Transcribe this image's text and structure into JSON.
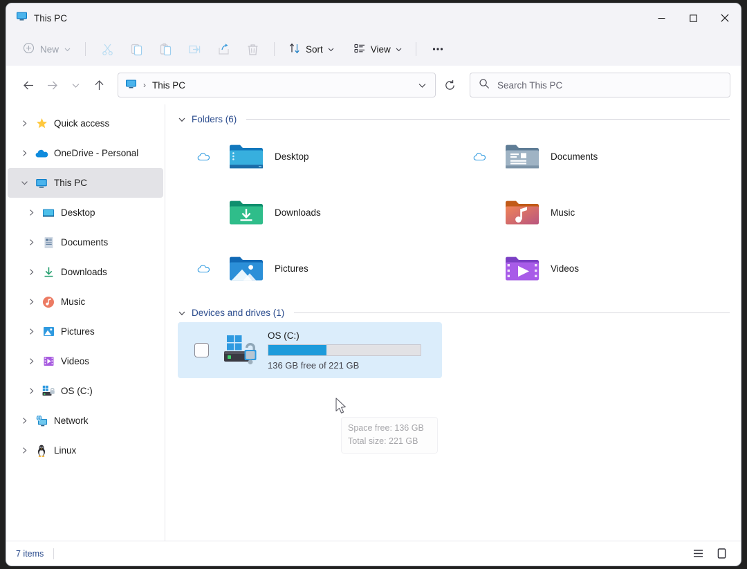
{
  "window": {
    "title": "This PC",
    "title_icon": "monitor-icon",
    "controls": {
      "minimize": "─",
      "maximize": "□",
      "close": "✕"
    }
  },
  "toolbar": {
    "new_label": "New",
    "sort_label": "Sort",
    "view_label": "View",
    "more_label": "•••",
    "icons": [
      "cut-icon",
      "copy-icon",
      "paste-icon",
      "rename-icon",
      "share-icon",
      "delete-icon"
    ]
  },
  "navigation": {
    "back_icon": "arrow-left-icon",
    "forward_icon": "arrow-right-icon",
    "history_icon": "chevron-down-icon",
    "up_icon": "arrow-up-icon",
    "refresh_icon": "refresh-icon",
    "breadcrumb": {
      "icon": "monitor-icon",
      "separator": "›",
      "label": "This PC"
    },
    "dropdown_icon": "chevron-down-icon"
  },
  "search": {
    "placeholder": "Search This PC",
    "icon": "search-icon"
  },
  "sidebar": {
    "items": [
      {
        "label": "Quick access",
        "icon": "star-icon",
        "chevron": "collapsed",
        "indent": false,
        "selected": false
      },
      {
        "label": "OneDrive - Personal",
        "icon": "cloud-icon",
        "chevron": "collapsed",
        "indent": false,
        "selected": false
      },
      {
        "label": "This PC",
        "icon": "monitor-icon",
        "chevron": "expanded",
        "indent": false,
        "selected": true
      },
      {
        "label": "Desktop",
        "icon": "desktop-icon",
        "chevron": "collapsed",
        "indent": true,
        "selected": false
      },
      {
        "label": "Documents",
        "icon": "documents-icon",
        "chevron": "collapsed",
        "indent": true,
        "selected": false
      },
      {
        "label": "Downloads",
        "icon": "downloads-icon",
        "chevron": "collapsed",
        "indent": true,
        "selected": false
      },
      {
        "label": "Music",
        "icon": "music-icon",
        "chevron": "collapsed",
        "indent": true,
        "selected": false
      },
      {
        "label": "Pictures",
        "icon": "pictures-icon",
        "chevron": "collapsed",
        "indent": true,
        "selected": false
      },
      {
        "label": "Videos",
        "icon": "videos-icon",
        "chevron": "collapsed",
        "indent": true,
        "selected": false
      },
      {
        "label": "OS (C:)",
        "icon": "drive-icon",
        "chevron": "collapsed",
        "indent": true,
        "selected": false
      },
      {
        "label": "Network",
        "icon": "network-icon",
        "chevron": "collapsed",
        "indent": false,
        "selected": false
      },
      {
        "label": "Linux",
        "icon": "penguin-icon",
        "chevron": "collapsed",
        "indent": false,
        "selected": false
      }
    ]
  },
  "content": {
    "folders_group": {
      "title": "Folders (6)",
      "chevron": "expanded"
    },
    "folders": [
      {
        "name": "Desktop",
        "icon": "folder-desktop-icon",
        "cloud": true
      },
      {
        "name": "Documents",
        "icon": "folder-documents-icon",
        "cloud": true
      },
      {
        "name": "Downloads",
        "icon": "folder-downloads-icon",
        "cloud": false
      },
      {
        "name": "Music",
        "icon": "folder-music-icon",
        "cloud": false
      },
      {
        "name": "Pictures",
        "icon": "folder-pictures-icon",
        "cloud": true
      },
      {
        "name": "Videos",
        "icon": "folder-videos-icon",
        "cloud": false
      }
    ],
    "drives_group": {
      "title": "Devices and drives (1)",
      "chevron": "expanded"
    },
    "drives": [
      {
        "name": "OS (C:)",
        "free_text": "136 GB free of 221 GB",
        "free_gb": 136,
        "total_gb": 221,
        "used_percent": 38,
        "bar_color": "#1d9bdb",
        "selected": true,
        "checkbox_checked": false
      }
    ]
  },
  "tooltip": {
    "line1": "Space free: 136 GB",
    "line2": "Total size: 221 GB"
  },
  "statusbar": {
    "items_text": "7 items",
    "view_details_icon": "list-view-icon",
    "view_large_icon": "large-icons-view-icon"
  }
}
